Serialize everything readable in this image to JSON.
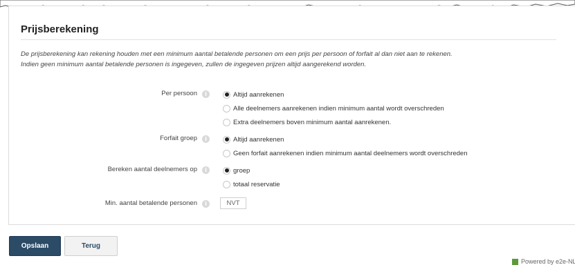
{
  "section": {
    "title": "Prijsberekening",
    "description_line1": "De prijsberekening kan rekening houden met een minimum aantal betalende personen om een prijs per persoon of forfait al dan niet aan te rekenen.",
    "description_line2": "Indien geen minimum aantal betalende personen is ingegeven, zullen de ingegeven prijzen altijd aangerekend worden."
  },
  "form": {
    "per_persoon": {
      "label": "Per persoon",
      "options": [
        {
          "label": "Altijd aanrekenen",
          "selected": true
        },
        {
          "label": "Alle deelnemers aanrekenen indien minimum aantal wordt overschreden",
          "selected": false
        },
        {
          "label": "Extra deelnemers boven minimum aantal aanrekenen.",
          "selected": false
        }
      ]
    },
    "forfait_groep": {
      "label": "Forfait groep",
      "options": [
        {
          "label": "Altijd aanrekenen",
          "selected": true
        },
        {
          "label": "Geen forfait aanrekenen indien minimum aantal deelnemers wordt overschreden",
          "selected": false
        }
      ]
    },
    "bereken": {
      "label": "Bereken aantal deelnemers op",
      "options": [
        {
          "label": "groep",
          "selected": true
        },
        {
          "label": "totaal reservatie",
          "selected": false
        }
      ]
    },
    "min_betalend": {
      "label": "Min. aantal betalende personen",
      "value": "NVT"
    },
    "info_icon_glyph": "i"
  },
  "buttons": {
    "save": "Opslaan",
    "back": "Terug"
  },
  "footer": {
    "powered": "Powered by e2e-NL"
  },
  "colors": {
    "primary_button": "#2b4b66",
    "info_icon": "#d9d9d9"
  }
}
